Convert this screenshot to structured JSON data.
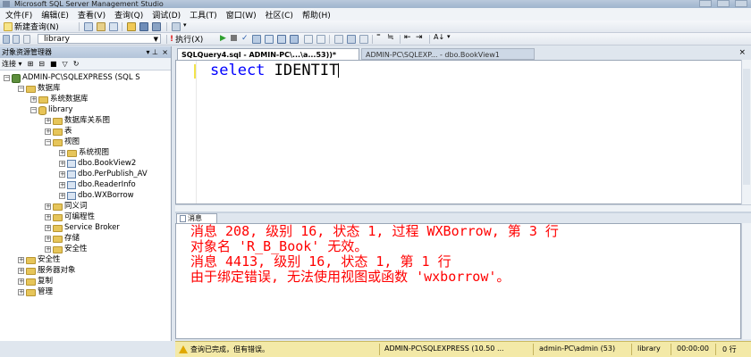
{
  "window": {
    "title": "Microsoft SQL Server Management Studio"
  },
  "menu": [
    "文件(F)",
    "编辑(E)",
    "查看(V)",
    "查询(Q)",
    "调试(D)",
    "工具(T)",
    "窗口(W)",
    "社区(C)",
    "帮助(H)"
  ],
  "toolbar": {
    "new_query_label": "新建查询(N)",
    "database_selected": "library",
    "execute_label": "执行(X)"
  },
  "object_explorer": {
    "title": "对象资源管理器",
    "connect_label": "连接",
    "tree": [
      {
        "label": "ADMIN-PC\\SQLEXPRESS (SQL S",
        "icon": "server-icon"
      },
      {
        "label": "数据库",
        "icon": "folder-icon"
      },
      {
        "label": "系统数据库",
        "icon": "folder-icon"
      },
      {
        "label": "library",
        "icon": "database-icon"
      },
      {
        "label": "数据库关系图",
        "icon": "folder-icon"
      },
      {
        "label": "表",
        "icon": "folder-icon"
      },
      {
        "label": "视图",
        "icon": "folder-icon"
      },
      {
        "label": "系统视图",
        "icon": "folder-icon"
      },
      {
        "label": "dbo.BookView2",
        "icon": "view-icon"
      },
      {
        "label": "dbo.PerPublish_AV",
        "icon": "view-icon"
      },
      {
        "label": "dbo.ReaderInfo",
        "icon": "view-icon"
      },
      {
        "label": "dbo.WXBorrow",
        "icon": "view-icon"
      },
      {
        "label": "同义词",
        "icon": "folder-icon"
      },
      {
        "label": "可编程性",
        "icon": "folder-icon"
      },
      {
        "label": "Service Broker",
        "icon": "folder-icon"
      },
      {
        "label": "存储",
        "icon": "folder-icon"
      },
      {
        "label": "安全性",
        "icon": "folder-icon"
      },
      {
        "label": "安全性",
        "icon": "folder-icon"
      },
      {
        "label": "服务器对象",
        "icon": "folder-icon"
      },
      {
        "label": "复制",
        "icon": "folder-icon"
      },
      {
        "label": "管理",
        "icon": "folder-icon"
      }
    ]
  },
  "tabs": {
    "active": "SQLQuery4.sql - ADMIN-PC\\...\\a...53))*",
    "inactive": "ADMIN-PC\\SQLEXP... - dbo.BookView1"
  },
  "editor": {
    "keyword": "select",
    "text": "IDENTIT"
  },
  "results": {
    "tab_label": "消息",
    "messages": [
      "消息 208, 级别 16, 状态 1, 过程 WXBorrow, 第 3 行",
      "对象名 'R_B_Book' 无效。",
      "消息 4413, 级别 16, 状态 1, 第 1 行",
      "由于绑定错误, 无法使用视图或函数 'wxborrow'。"
    ]
  },
  "status": {
    "message": "查询已完成，但有错误。",
    "server": "ADMIN-PC\\SQLEXPRESS (10.50 ...",
    "user": "admin-PC\\admin (53)",
    "database": "library",
    "time": "00:00:00",
    "rows": "0 行"
  }
}
